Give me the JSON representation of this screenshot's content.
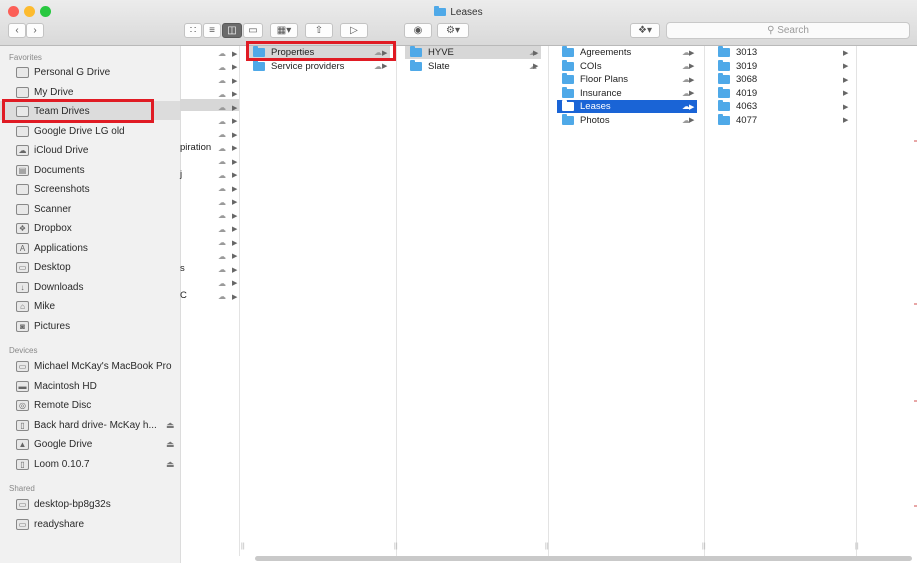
{
  "window": {
    "title": "Leases",
    "colors": {
      "close": "#fc5f57",
      "minimize": "#fdbb2e",
      "zoom": "#28c840",
      "selection_blue": "#1a64d6",
      "folder": "#4fa9e8",
      "highlight_red": "#e01b24"
    }
  },
  "toolbar": {
    "back_icon": "chevron-left-icon",
    "forward_icon": "chevron-right-icon",
    "view_icons": [
      "icon-view-icon",
      "list-view-icon",
      "column-view-icon",
      "cover-flow-icon"
    ],
    "arrange_icon": "arrange-grid-icon",
    "share_icon": "share-icon",
    "tag_icon": "tag-icon",
    "quicklook_icon": "eye-icon",
    "action_icon": "gear-icon",
    "dropbox_icon": "dropbox-icon",
    "search_placeholder": "Search"
  },
  "sidebar": {
    "favorites_label": "Favorites",
    "favorites": [
      {
        "label": "Personal G Drive",
        "icon": "folder-icon"
      },
      {
        "label": "My Drive",
        "icon": "folder-icon"
      },
      {
        "label": "Team Drives",
        "icon": "folder-icon"
      },
      {
        "label": "Google Drive LG old",
        "icon": "folder-icon"
      },
      {
        "label": "iCloud Drive",
        "icon": "cloud-icon"
      },
      {
        "label": "Documents",
        "icon": "documents-icon"
      },
      {
        "label": "Screenshots",
        "icon": "folder-icon"
      },
      {
        "label": "Scanner",
        "icon": "folder-icon"
      },
      {
        "label": "Dropbox",
        "icon": "dropbox-icon"
      },
      {
        "label": "Applications",
        "icon": "applications-icon"
      },
      {
        "label": "Desktop",
        "icon": "desktop-icon"
      },
      {
        "label": "Downloads",
        "icon": "download-icon"
      },
      {
        "label": "Mike",
        "icon": "home-icon"
      },
      {
        "label": "Pictures",
        "icon": "camera-icon"
      }
    ],
    "devices_label": "Devices",
    "devices": [
      {
        "label": "Michael McKay's MacBook Pro",
        "icon": "laptop-icon"
      },
      {
        "label": "Macintosh HD",
        "icon": "harddisk-icon"
      },
      {
        "label": "Remote Disc",
        "icon": "disc-icon"
      },
      {
        "label": "Back hard drive- McKay h...",
        "icon": "external-drive-icon",
        "eject": "⏏"
      },
      {
        "label": "Google Drive",
        "icon": "drive-icon",
        "eject": "⏏"
      },
      {
        "label": "Loom 0.10.7",
        "icon": "disk-image-icon",
        "eject": "⏏"
      }
    ],
    "shared_label": "Shared",
    "shared": [
      {
        "label": "desktop-bp8g32s",
        "icon": "computer-icon"
      },
      {
        "label": "readyshare",
        "icon": "computer-icon"
      }
    ]
  },
  "columns": {
    "col1_fragments": [
      "piration",
      "j",
      "s",
      "C"
    ],
    "col2": [
      "Properties",
      "Service providers"
    ],
    "col3": [
      "HYVE",
      "Slate"
    ],
    "col4": [
      "Agreements",
      "COIs",
      "Floor Plans",
      "Insurance",
      "Leases",
      "Photos"
    ],
    "col5": [
      "3013",
      "3019",
      "3068",
      "4019",
      "4063",
      "4077"
    ]
  }
}
